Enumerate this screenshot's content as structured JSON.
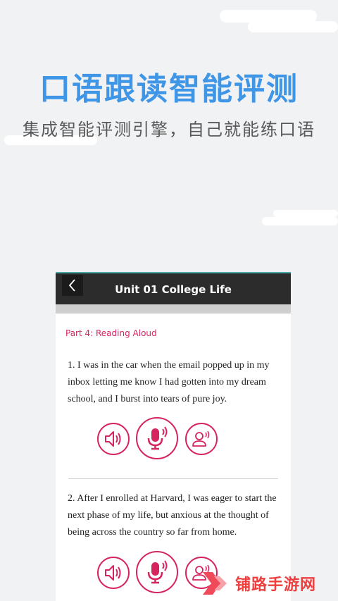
{
  "promo": {
    "headline": "口语跟读智能评测",
    "subline": "集成智能评测引擎，自己就能练口语"
  },
  "screen": {
    "title": "Unit 01 College Life",
    "part_label": "Part 4: Reading Aloud",
    "items": [
      {
        "text": "1. I was in the car when the email popped up in my inbox letting me know I had gotten into my dream school, and I burst into tears of pure joy."
      },
      {
        "text": "2. After I enrolled at Harvard, I was eager to start the next phase of my life, but anxious at the thought of being across the country so far from home."
      }
    ]
  },
  "watermark": {
    "text": "铺路手游网"
  },
  "colors": {
    "accent": "#d6245f",
    "headline": "#3f95e6",
    "topbar": "#2c2c2c",
    "watermark": "#ee3e3e"
  },
  "icons": {
    "back": "back-arrow-icon",
    "play": "speaker-icon",
    "record": "microphone-icon",
    "user": "user-voice-icon"
  }
}
